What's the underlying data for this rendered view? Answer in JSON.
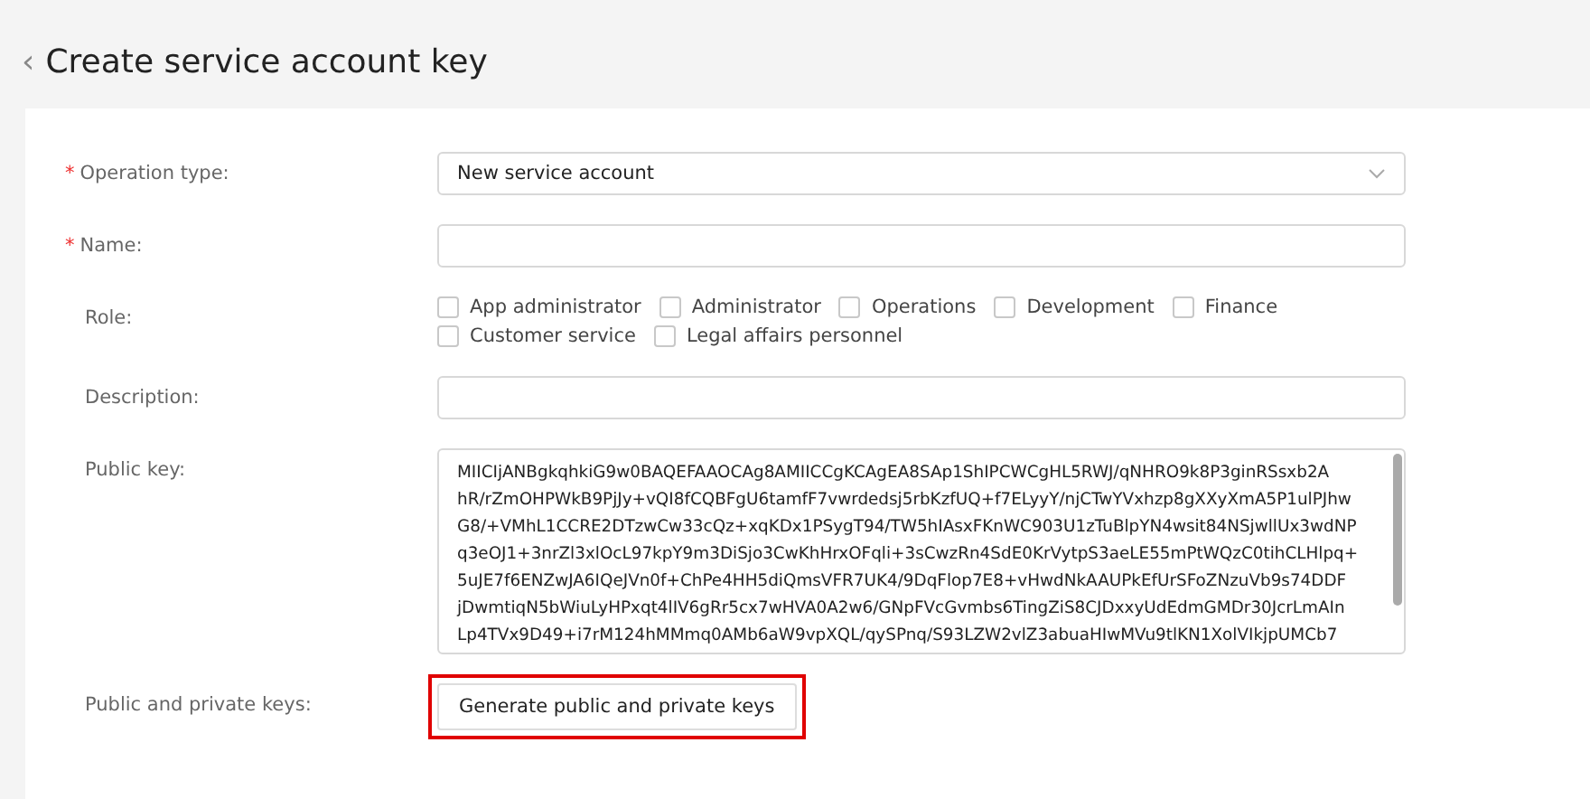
{
  "header": {
    "back_icon": "‹",
    "title": "Create service account key"
  },
  "form": {
    "fields": [
      {
        "kind": "select",
        "label": "Operation type:",
        "marker": "*",
        "value": "New service account"
      },
      {
        "kind": "text",
        "label": "Name:",
        "marker": "*"
      },
      {
        "kind": "checkboxes",
        "label": "Role:",
        "options": [
          {
            "label": "App administrator",
            "checked": false
          },
          {
            "label": "Administrator",
            "checked": false
          },
          {
            "label": "Operations",
            "checked": false
          },
          {
            "label": "Development",
            "checked": false
          },
          {
            "label": "Finance",
            "checked": false
          },
          {
            "label": "Customer service",
            "checked": false
          },
          {
            "label": "Legal affairs personnel",
            "checked": false
          }
        ]
      },
      {
        "kind": "text",
        "label": "Description:"
      },
      {
        "kind": "textarea",
        "label": "Public key:",
        "lines": [
          "MIICIjANBgkqhkiG9w0BAQEFAAOCAg8AMIICCgKCAgEA8SAp1ShIPCWCgHL5RWJ/qNHRO9k8P3ginRSsxb2A",
          "hR/rZmOHPWkB9PjJy+vQI8fCQBFgU6tamfF7vwrdedsj5rbKzfUQ+f7ELyyY/njCTwYVxhzp8gXXyXmA5P1ulPJhw",
          "G8/+VMhL1CCRE2DTzwCw33cQz+xqKDx1PSygT94/TW5hIAsxFKnWC903U1zTuBlpYN4wsit84NSjwllUx3wdNP",
          "q3eOJ1+3nrZl3xlOcL97kpY9m3DiSjo3CwKhHrxOFqli+3sCwzRn4SdE0KrVytpS3aeLE55mPtWQzC0tihCLHlpq+",
          "5uJE7f6ENZwJA6IQeJVn0f+ChPe4HH5diQmsVFR7UK4/9DqFlop7E8+vHwdNkAAUPkEfUrSFoZNzuVb9s74DDF",
          "jDwmtiqN5bWiuLyHPxqt4lIV6gRr5cx7wHVA0A2w6/GNpFVcGvmbs6TingZiS8CJDxxyUdEdmGMDr30JcrLmAIn",
          "Lp4TVx9D49+i7rM124hMMmq0AMb6aW9vpXQL/qySPnq/S93LZW2vlZ3abuaHIwMVu9tlKN1XolVIkjpUMCb7"
        ]
      },
      {
        "kind": "button",
        "label": "Public and private keys:",
        "button": "Generate public and private keys",
        "highlighted": true
      }
    ]
  }
}
